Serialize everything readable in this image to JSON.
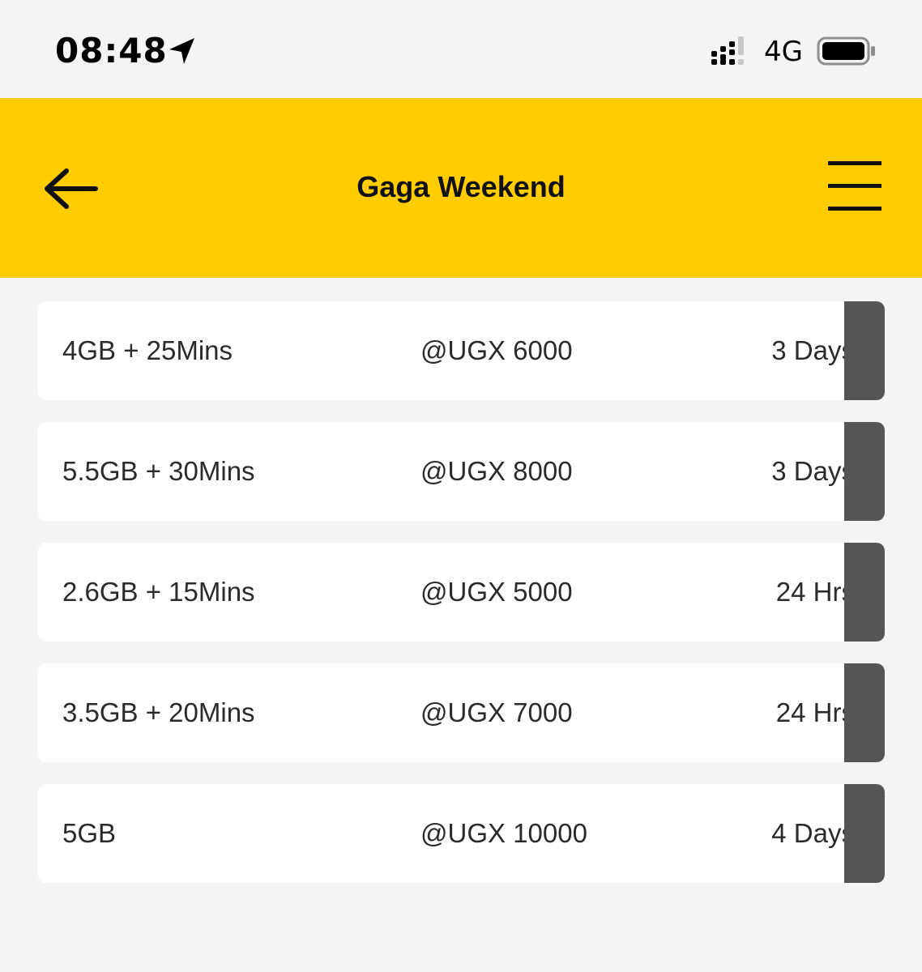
{
  "status_bar": {
    "time": "08:48",
    "network": "4G",
    "icons": [
      "location-arrow-icon",
      "signal-icon",
      "battery-icon"
    ]
  },
  "header": {
    "title": "Gaga Weekend",
    "back_icon": "arrow-left-icon",
    "menu_icon": "hamburger-menu-icon",
    "background_color": "#ffcc00"
  },
  "bundles": [
    {
      "size": "4GB + 25Mins",
      "price": "@UGX 6000",
      "validity": "3 Days"
    },
    {
      "size": "5.5GB + 30Mins",
      "price": "@UGX 8000",
      "validity": "3 Days"
    },
    {
      "size": "2.6GB + 15Mins",
      "price": "@UGX 5000",
      "validity": "24 Hrs"
    },
    {
      "size": "3.5GB + 20Mins",
      "price": "@UGX 7000",
      "validity": "24 Hrs"
    },
    {
      "size": "5GB",
      "price": "@UGX 10000",
      "validity": "4 Days"
    }
  ],
  "colors": {
    "accent": "#ffcc00",
    "background": "#f4f4f4",
    "card": "#ffffff",
    "handle": "#555555"
  }
}
